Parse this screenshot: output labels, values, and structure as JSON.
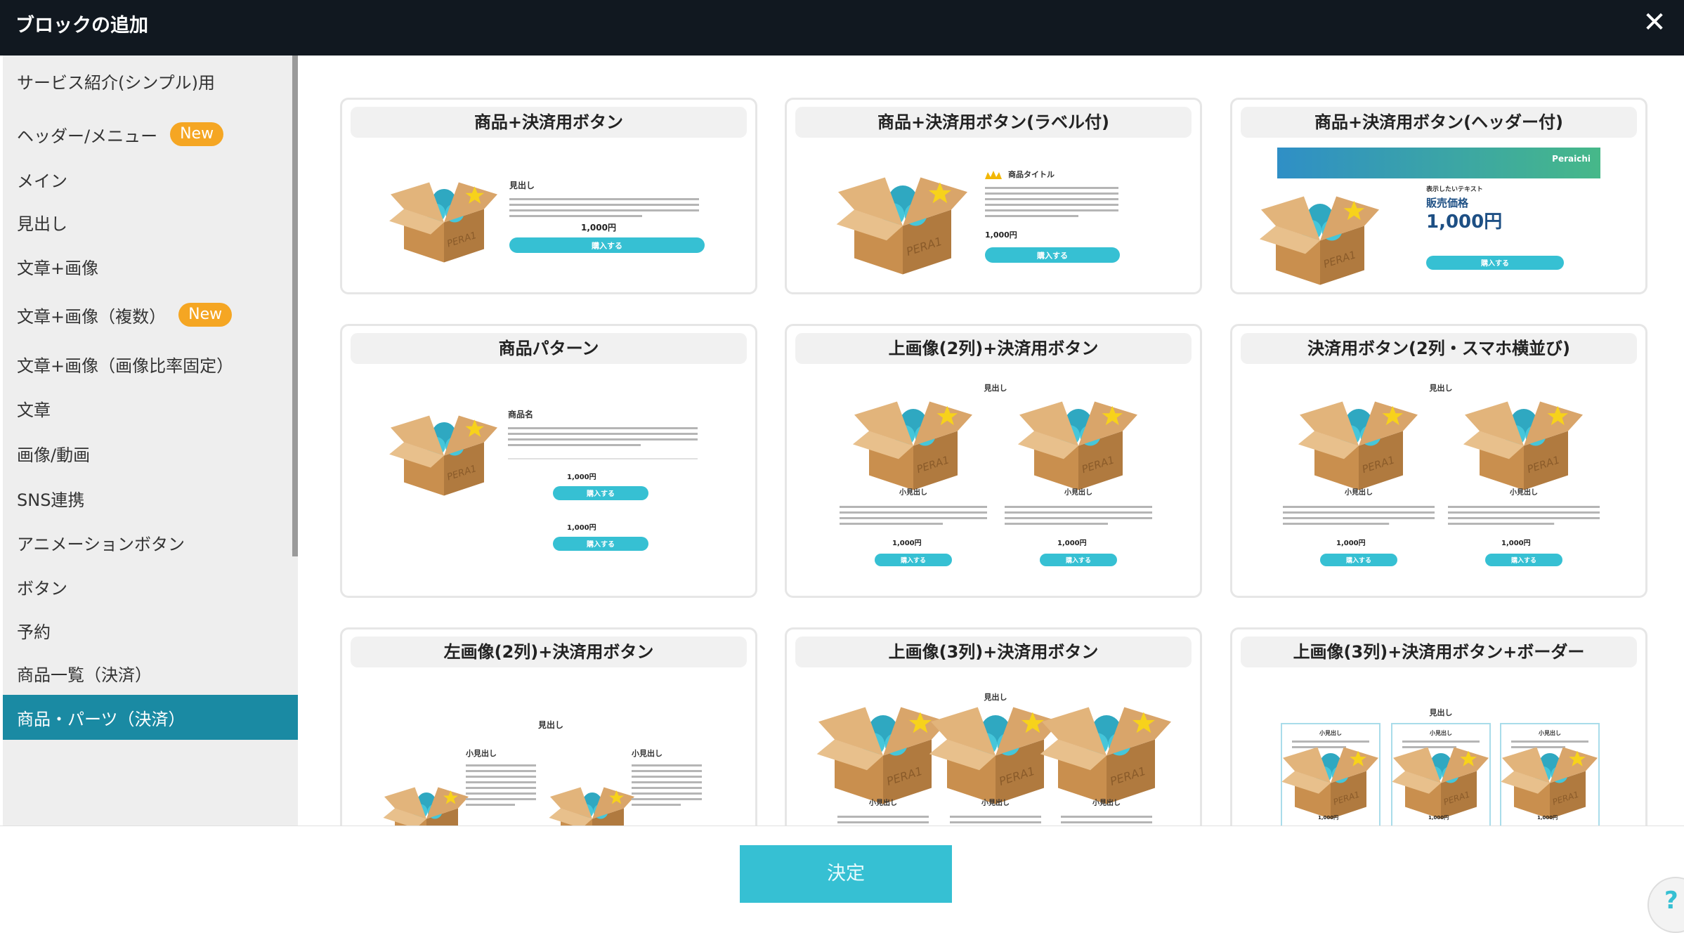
{
  "header": {
    "title": "ブロックの追加",
    "close_label": "✕"
  },
  "sidebar": {
    "items": [
      {
        "label": "サービス紹介(シンプル)用",
        "badge": ""
      },
      {
        "label": "ヘッダー/メニュー",
        "badge": "New"
      },
      {
        "label": "メイン",
        "badge": ""
      },
      {
        "label": "見出し",
        "badge": ""
      },
      {
        "label": "文章+画像",
        "badge": ""
      },
      {
        "label": "文章+画像（複数）",
        "badge": "New"
      },
      {
        "label": "文章+画像（画像比率固定）",
        "badge": ""
      },
      {
        "label": "文章",
        "badge": ""
      },
      {
        "label": "画像/動画",
        "badge": ""
      },
      {
        "label": "SNS連携",
        "badge": ""
      },
      {
        "label": "アニメーションボタン",
        "badge": ""
      },
      {
        "label": "ボタン",
        "badge": ""
      },
      {
        "label": "予約",
        "badge": ""
      },
      {
        "label": "商品一覧（決済）",
        "badge": ""
      },
      {
        "label": "商品・パーツ（決済）",
        "badge": "",
        "active": true
      }
    ]
  },
  "cards": [
    {
      "title": "商品+決済用ボタン"
    },
    {
      "title": "商品+決済用ボタン(ラベル付)"
    },
    {
      "title": "商品+決済用ボタン(ヘッダー付)"
    },
    {
      "title": "商品パターン"
    },
    {
      "title": "上画像(2列)+決済用ボタン"
    },
    {
      "title": "決済用ボタン(2列・スマホ横並び)"
    },
    {
      "title": "左画像(2列)+決済用ボタン"
    },
    {
      "title": "上画像(3列)+決済用ボタン"
    },
    {
      "title": "上画像(3列)+決済用ボタン+ボーダー"
    }
  ],
  "preview_text": {
    "heading": "見出し",
    "sub_heading": "小見出し",
    "product_title": "商品タイトル",
    "product_name": "商品名",
    "price": "1,000円",
    "price_small": "1,000円",
    "buy": "購入する",
    "brand": "Peraichi",
    "display_text": "表示したいテキスト",
    "sale_price": "販売価格",
    "box_label": "PERA1"
  },
  "footer": {
    "decide_label": "決定"
  },
  "help": {
    "label": "?"
  },
  "colors": {
    "accent": "#36c0d3",
    "active_sidebar": "#1a8aa3",
    "badge": "#f5a623",
    "header_bg": "#111820"
  }
}
